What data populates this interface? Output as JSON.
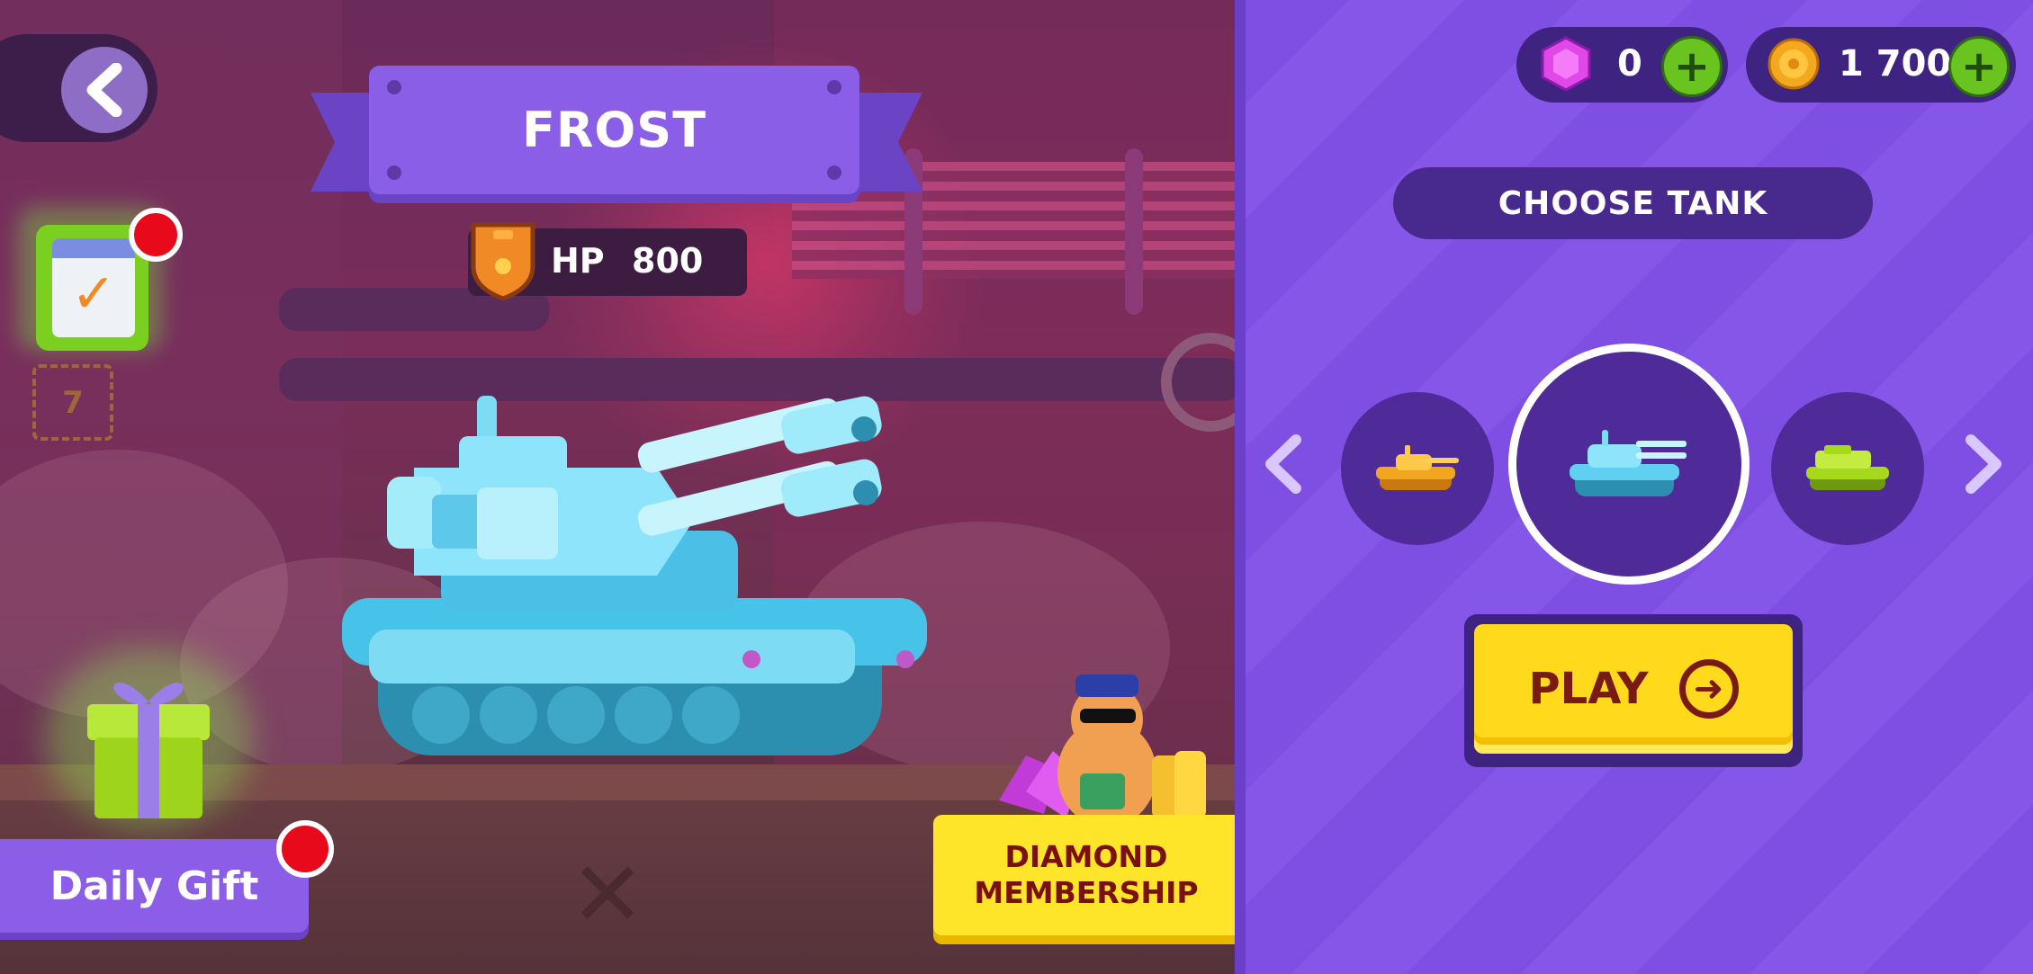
{
  "screen": {
    "title": "FROST",
    "hp_label": "HP",
    "hp_value": "800"
  },
  "left_buttons": {
    "daily_gift": "Daily Gift",
    "diamond_membership_line1": "DIAMOND",
    "diamond_membership_line2": "MEMBERSHIP",
    "calendar_day": "7"
  },
  "currency": {
    "gems": "0",
    "coins": "1 700"
  },
  "panel": {
    "choose_label": "CHOOSE TANK",
    "play_label": "PLAY",
    "tanks": [
      {
        "name": "orange-tank",
        "color": "#f2a51f"
      },
      {
        "name": "frost-tank",
        "color": "#5fd0f0",
        "selected": true
      },
      {
        "name": "green-tank",
        "color": "#a6d81e"
      }
    ]
  },
  "colors": {
    "accent": "#8b5ee8",
    "panel": "#7f4fe4",
    "play": "#ffd91c",
    "notify": "#e8091a",
    "plus": "#69c420"
  }
}
